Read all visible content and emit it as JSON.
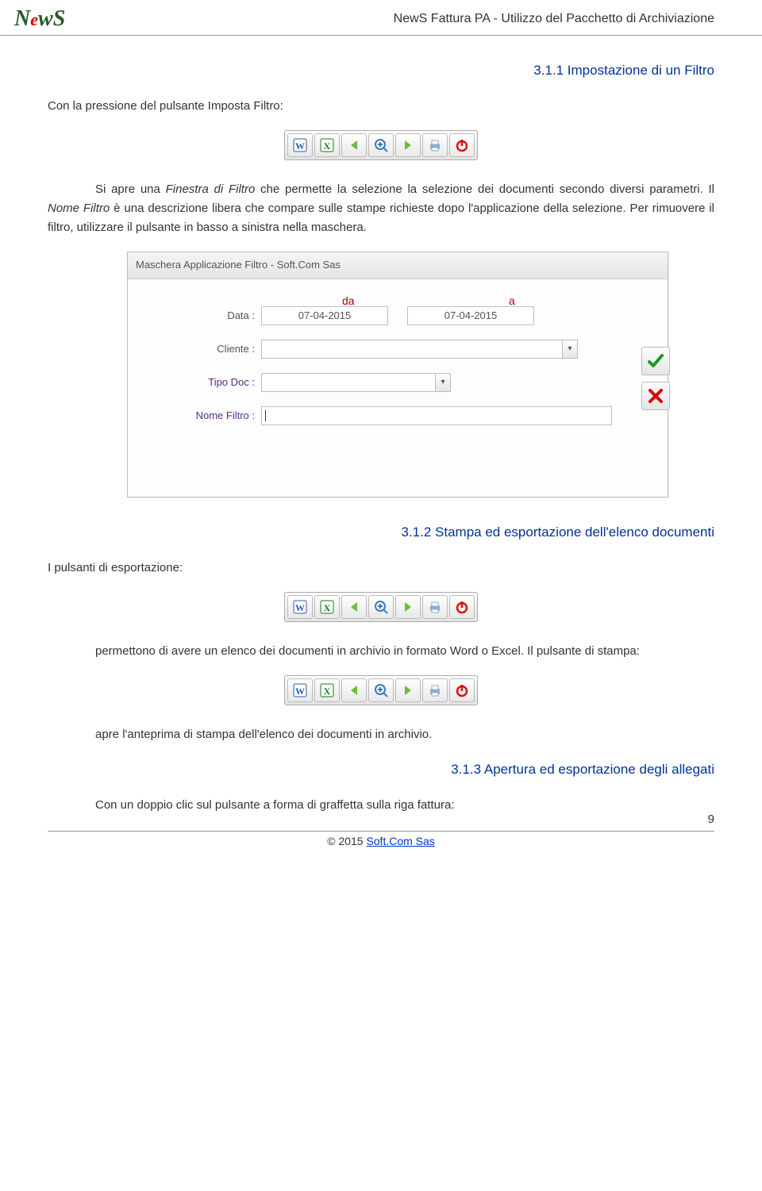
{
  "header": {
    "logo_text": "NewS",
    "doc_title": "NewS  Fattura PA -  Utilizzo del Pacchetto di Archiviazione"
  },
  "section1": {
    "heading": "3.1.1 Impostazione di un Filtro",
    "intro": "Con la pressione del pulsante Imposta Filtro:",
    "para1_a": "Si apre una ",
    "term1": "Finestra di Filtro",
    "para1_b": " che permette la selezione la selezione dei documenti secondo diversi parametri. Il ",
    "term2": "Nome Filtro",
    "para1_c": " è una descrizione libera che compare sulle stampe richieste dopo l'applicazione della selezione. Per rimuovere il filtro, utilizzare il pulsante in basso a sinistra nella maschera."
  },
  "dialog": {
    "title": "Maschera Applicazione Filtro - Soft.Com Sas",
    "col_da": "da",
    "col_a": "a",
    "rows": {
      "data_label": "Data :",
      "data_da": "07-04-2015",
      "data_a": "07-04-2015",
      "cliente_label": "Cliente :",
      "cliente_value": "",
      "tipo_label": "Tipo Doc :",
      "tipo_value": "",
      "nome_label": "Nome Filtro :",
      "nome_value": ""
    }
  },
  "section2": {
    "heading": "3.1.2 Stampa ed esportazione dell'elenco documenti",
    "intro": "I pulsanti di esportazione:",
    "para_a": "permettono di avere un elenco dei documenti in archivio in formato Word o Excel. Il pulsante di stampa:",
    "para_b": "apre l'anteprima di stampa dell'elenco dei documenti in archivio."
  },
  "section3": {
    "heading": "3.1.3 Apertura ed esportazione degli allegati",
    "para": "Con un doppio clic sul pulsante a forma di graffetta sulla riga fattura:"
  },
  "footer": {
    "copyright_prefix": "© 2015 ",
    "link_text": "Soft.Com Sas",
    "page_number": "9"
  },
  "icons": {
    "word": "W",
    "excel": "X",
    "prev": "←",
    "zoom": "⊕",
    "next": "→",
    "print": "🖨",
    "power": "⏻",
    "ok": "✓",
    "cancel": "X",
    "dropdown": "▾"
  }
}
